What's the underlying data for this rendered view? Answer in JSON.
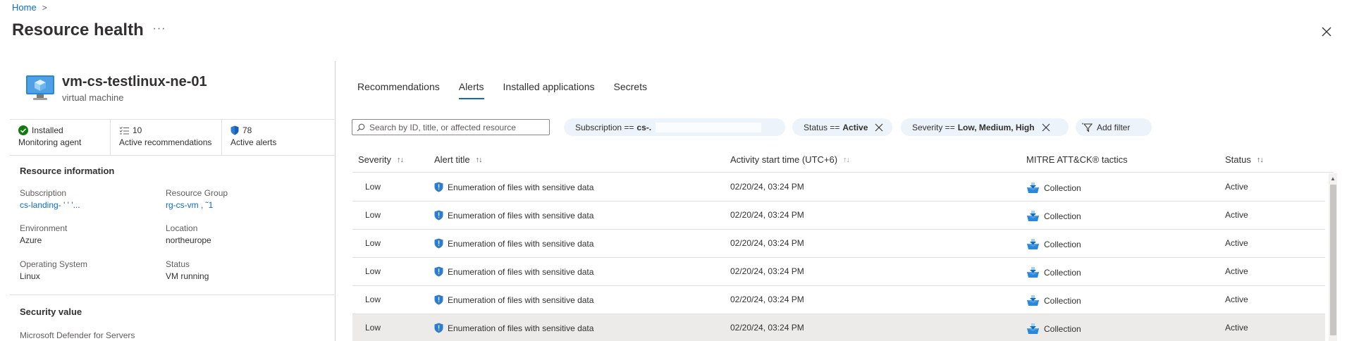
{
  "breadcrumb": {
    "home": "Home",
    "separator": ">"
  },
  "page": {
    "title": "Resource health",
    "more": "···"
  },
  "resource": {
    "name": "vm-cs-testlinux-ne-01",
    "type": "virtual machine"
  },
  "stats": {
    "agent_value": "Installed",
    "agent_label": "Monitoring agent",
    "recommendations_value": "10",
    "recommendations_label": "Active recommendations",
    "alerts_value": "78",
    "alerts_label": "Active alerts"
  },
  "resource_info": {
    "title": "Resource information",
    "subscription_key": "Subscription",
    "subscription_value": "cs-landing-  '      '      '...",
    "resource_group_key": "Resource Group",
    "resource_group_value": "rg-cs-vm  ,         ˜1",
    "environment_key": "Environment",
    "environment_value": "Azure",
    "location_key": "Location",
    "location_value": "northeurope",
    "os_key": "Operating System",
    "os_value": "Linux",
    "status_key": "Status",
    "status_value": "VM running"
  },
  "security_value": {
    "title": "Security value",
    "subtitle": "Microsoft Defender for Servers"
  },
  "tabs": [
    "Recommendations",
    "Alerts",
    "Installed applications",
    "Secrets"
  ],
  "active_tab": "Alerts",
  "search": {
    "placeholder": "Search by ID, title, or affected resource"
  },
  "filters": {
    "subscription_label": "Subscription == ",
    "subscription_value": "cs-.",
    "status_label": "Status == ",
    "status_value": "Active",
    "severity_label": "Severity == ",
    "severity_value": "Low, Medium, High",
    "add_filter": "Add filter"
  },
  "table": {
    "headers": {
      "severity": "Severity",
      "title": "Alert title",
      "time": "Activity start time (UTC+6)",
      "mitre": "MITRE ATT&CK® tactics",
      "status": "Status"
    },
    "rows": [
      {
        "severity": "Low",
        "title": "Enumeration of files with sensitive data",
        "time": "02/20/24, 03:24 PM",
        "mitre": "Collection",
        "status": "Active"
      },
      {
        "severity": "Low",
        "title": "Enumeration of files with sensitive data",
        "time": "02/20/24, 03:24 PM",
        "mitre": "Collection",
        "status": "Active"
      },
      {
        "severity": "Low",
        "title": "Enumeration of files with sensitive data",
        "time": "02/20/24, 03:24 PM",
        "mitre": "Collection",
        "status": "Active"
      },
      {
        "severity": "Low",
        "title": "Enumeration of files with sensitive data",
        "time": "02/20/24, 03:24 PM",
        "mitre": "Collection",
        "status": "Active"
      },
      {
        "severity": "Low",
        "title": "Enumeration of files with sensitive data",
        "time": "02/20/24, 03:24 PM",
        "mitre": "Collection",
        "status": "Active"
      },
      {
        "severity": "Low",
        "title": "Enumeration of files with sensitive data",
        "time": "02/20/24, 03:24 PM",
        "mitre": "Collection",
        "status": "Active"
      }
    ]
  },
  "colors": {
    "accent": "#0f6cbd",
    "success": "#107c10",
    "shield": "#2b7cd3",
    "selected_row": "#edebe9"
  },
  "icons": [
    "vm-icon",
    "check-circle-icon",
    "list-icon",
    "shield-icon",
    "search-icon",
    "close-icon",
    "filter-add-icon",
    "collection-icon"
  ]
}
